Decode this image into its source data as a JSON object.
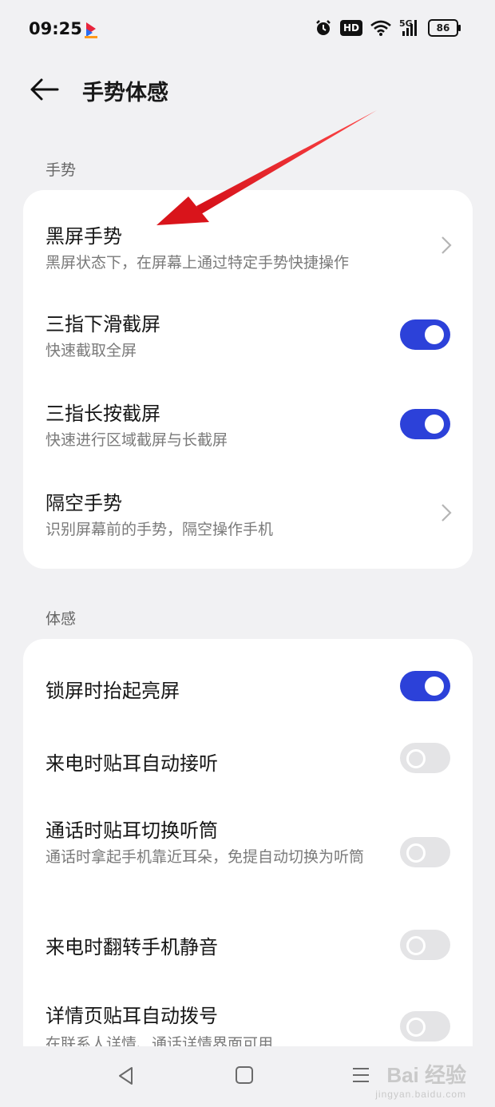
{
  "status_bar": {
    "time": "09:25",
    "hd": "HD",
    "network": "5G",
    "battery": "86",
    "icons": [
      "app-logo-icon",
      "alarm-icon",
      "hd-icon",
      "wifi-icon",
      "signal-icon",
      "battery-icon"
    ]
  },
  "header": {
    "title": "手势体感",
    "back_icon": "arrow-left-icon"
  },
  "sections": [
    {
      "label": "手势",
      "items": [
        {
          "title": "黑屏手势",
          "subtitle": "黑屏状态下，在屏幕上通过特定手势快捷操作",
          "control": "chevron"
        },
        {
          "title": "三指下滑截屏",
          "subtitle": "快速截取全屏",
          "control": "toggle",
          "on": true
        },
        {
          "title": "三指长按截屏",
          "subtitle": "快速进行区域截屏与长截屏",
          "control": "toggle",
          "on": true
        },
        {
          "title": "隔空手势",
          "subtitle": "识别屏幕前的手势，隔空操作手机",
          "control": "chevron"
        }
      ]
    },
    {
      "label": "体感",
      "items": [
        {
          "title": "锁屏时抬起亮屏",
          "control": "toggle",
          "on": true
        },
        {
          "title": "来电时贴耳自动接听",
          "control": "toggle",
          "on": false
        },
        {
          "title": "通话时贴耳切换听筒",
          "subtitle": "通话时拿起手机靠近耳朵，免提自动切换为听筒",
          "control": "toggle",
          "on": false
        },
        {
          "title": "来电时翻转手机静音",
          "control": "toggle",
          "on": false
        },
        {
          "title": "详情页贴耳自动拨号",
          "subtitle": "在联系人详情、通话详情界面可用",
          "control": "toggle",
          "on": false
        }
      ]
    }
  ],
  "nav_bar": {
    "icons": [
      "back-triangle-icon",
      "home-square-icon",
      "menu-lines-icon"
    ],
    "watermark_main": "Bai 经验",
    "watermark_sub": "jingyan.baidu.com"
  },
  "colors": {
    "accent": "#2c41d9",
    "annotation_arrow": "#e0141c",
    "background": "#f1f1f3",
    "card": "#ffffff"
  }
}
